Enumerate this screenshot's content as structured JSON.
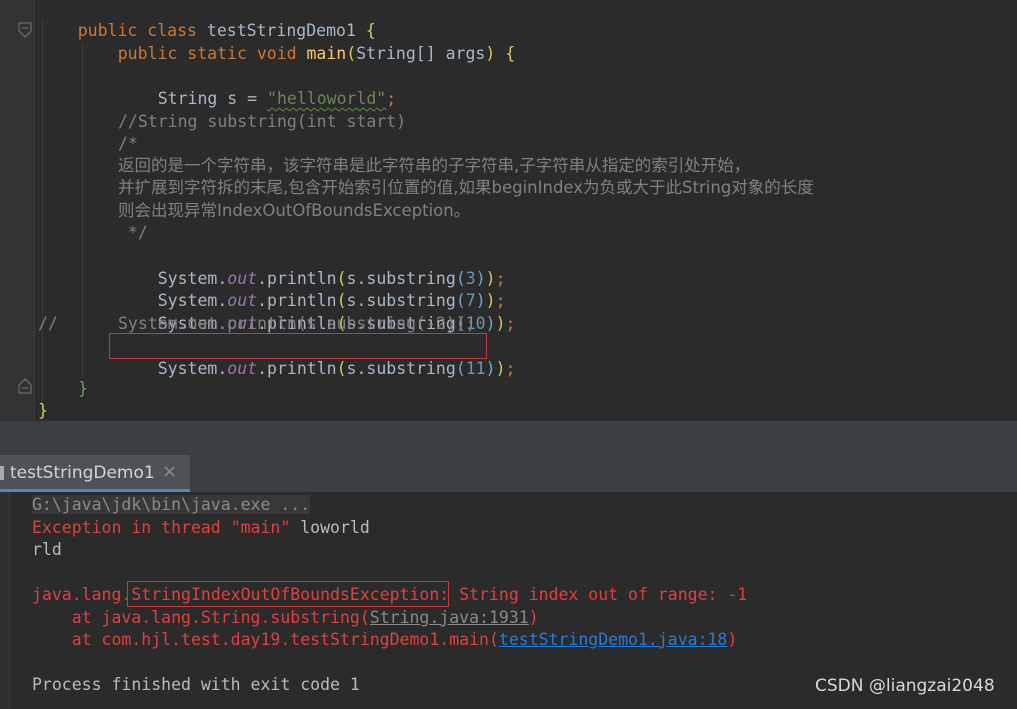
{
  "editor": {
    "lines": {
      "l1": {
        "kw": "public class ",
        "name": "testStringDemo1",
        "brace": " {"
      },
      "l2": {
        "kw": "public static void ",
        "fn": "main",
        "open": "(",
        "type": "String[] args",
        "close": ")",
        "brace": " {"
      },
      "l3": {
        "decl": "String s = ",
        "str": "\"helloworld\"",
        "semi": ";"
      },
      "l4": {
        "cmt": "//String substring(int start)"
      },
      "l5": {
        "cmt": "/*"
      },
      "l6": {
        "cmt": "返回的是一个字符串，该字符串是此字符串的子字符串,子字符串从指定的索引处开始，"
      },
      "l7": {
        "cmt": "并扩展到字符拆的末尾,包含开始索引位置的值,如果beginIndex为负或大于此String对象的长度"
      },
      "l8": {
        "cmt": "则会出现异常IndexOutOfBoundsException。"
      },
      "l9": {
        "cmt": " */"
      },
      "p3": {
        "sys": "System.",
        "out": "out",
        "println": ".println",
        "o1": "(",
        "call": "s.substring",
        "o2": "(",
        "arg": "3",
        "c2": ")",
        "c1": ")",
        "semi": ";"
      },
      "p7": {
        "sys": "System.",
        "out": "out",
        "println": ".println",
        "o1": "(",
        "call": "s.substring",
        "o2": "(",
        "arg": "7",
        "c2": ")",
        "c1": ")",
        "semi": ";"
      },
      "p10": {
        "sys": "System.",
        "out": "out",
        "println": ".println",
        "o1": "(",
        "call": "s.substring",
        "o2": "(",
        "arg": "10",
        "c2": ")",
        "c1": ")",
        "semi": ";"
      },
      "pm2": {
        "prefix": "//",
        "code": "System.out.println(s.substring(-2));"
      },
      "p11": {
        "sys": "System.",
        "out": "out",
        "println": ".println",
        "o1": "(",
        "call": "s.substring",
        "o2": "(",
        "arg": "11",
        "c2": ")",
        "c1": ")",
        "semi": ";"
      },
      "close_method": "}",
      "close_class": "}"
    }
  },
  "run_tab": {
    "title": "testStringDemo1",
    "close_glyph": "×"
  },
  "console": {
    "path": "G:\\java\\jdk\\bin\\java.exe ...",
    "exc_prefix": "Exception in thread ",
    "exc_thread": "\"main\"",
    "exc_out": " loworld",
    "out2": "rld",
    "ex_pkg": "java.lang.",
    "ex_class": "StringIndexOutOfBoundsException",
    "ex_msg": ": String index out of range: -1",
    "at1_prefix": "    at java.lang.String.substring(",
    "at1_link": "String.java:1931",
    "at1_suffix": ")",
    "at2_prefix": "    at com.hjl.test.day19.testStringDemo1.main(",
    "at2_link": "testStringDemo1.java:18",
    "at2_suffix": ")",
    "finished": "Process finished with exit code 1"
  },
  "watermark": "CSDN @liangzai2048",
  "colors": {
    "keyword": "#cc7832",
    "string": "#6a8759",
    "number": "#6897bb",
    "comment": "#808080",
    "static_field": "#9876aa",
    "method_decl": "#ffc66d",
    "error": "#e0403f",
    "link": "#287bde",
    "highlight_box": "#c93b3b"
  }
}
